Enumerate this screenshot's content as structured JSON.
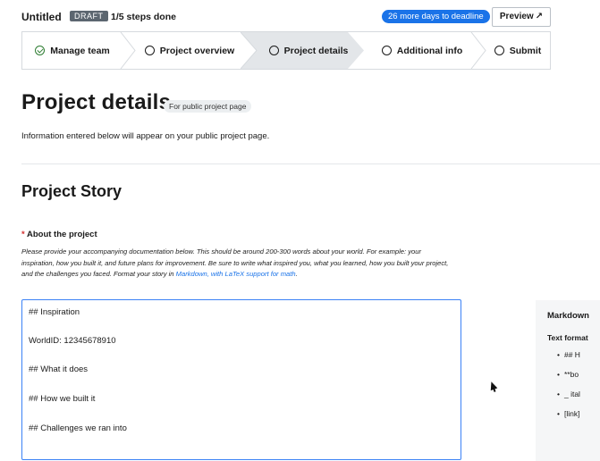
{
  "header": {
    "title": "Untitled",
    "badge": "DRAFT",
    "progress": "1/5 steps done",
    "deadline": "26 more days to deadline",
    "preview_label": "Preview"
  },
  "stepper": {
    "steps": [
      {
        "label": "Manage team",
        "state": "done"
      },
      {
        "label": "Project overview",
        "state": "todo"
      },
      {
        "label": "Project details",
        "state": "active"
      },
      {
        "label": "Additional info",
        "state": "todo"
      },
      {
        "label": "Submit",
        "state": "todo"
      }
    ]
  },
  "page": {
    "title": "Project details",
    "tag": "For public project page",
    "intro": "Information entered below will appear on your public project page."
  },
  "story": {
    "heading": "Project Story",
    "field_label": "About the project",
    "help_text": "Please provide your accompanying documentation below. This should be around 200-300 words about your world. For example: your inspiration, how you built it, and future plans for improvement. Be sure to write what inspired you, what you learned, how you built your project, and the challenges you faced. Format your story in ",
    "help_link": "Markdown, with LaTeX support for math",
    "help_end": "."
  },
  "editor": {
    "lines": [
      "## Inspiration",
      "WorldID: 12345678910",
      "## What it does",
      "## How we built it",
      "## Challenges we ran into"
    ]
  },
  "markdown_help": {
    "title": "Markdown",
    "subtitle": "Text format",
    "items": [
      "## H",
      "**bo",
      "_ ital",
      "[link]"
    ]
  },
  "colors": {
    "accent": "#1a73e8",
    "done": "#2e7d32",
    "editor_border": "#3b82f6",
    "badge_bg": "#5c6670",
    "active_step_bg": "#e3e6e9"
  }
}
